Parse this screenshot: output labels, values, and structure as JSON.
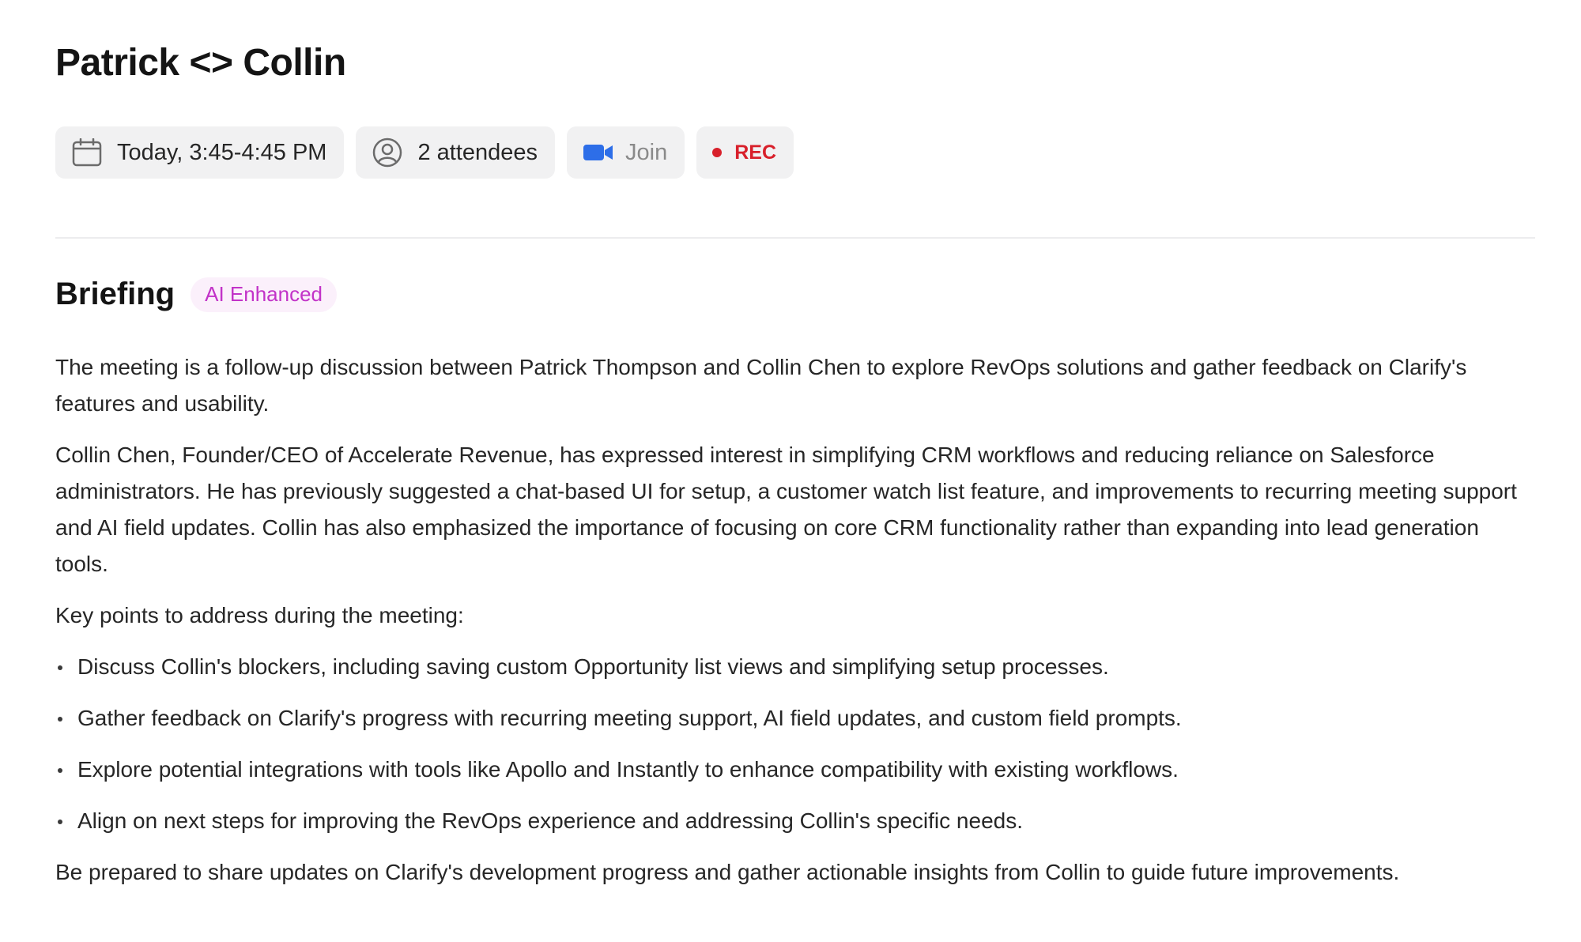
{
  "meeting": {
    "title": "Patrick <> Collin",
    "time": "Today, 3:45-4:45 PM",
    "attendees": "2 attendees",
    "join_label": "Join",
    "rec_label": "REC"
  },
  "briefing": {
    "heading": "Briefing",
    "badge": "AI Enhanced",
    "paragraphs": [
      "The meeting is a follow-up discussion between Patrick Thompson and Collin Chen to explore RevOps solutions and gather feedback on Clarify's features and usability.",
      "Collin Chen, Founder/CEO of Accelerate Revenue, has expressed interest in simplifying CRM workflows and reducing reliance on Salesforce administrators. He has previously suggested a chat-based UI for setup, a customer watch list feature, and improvements to recurring meeting support and AI field updates. Collin has also emphasized the importance of focusing on core CRM functionality rather than expanding into lead generation tools.",
      "Key points to address during the meeting:"
    ],
    "bullets": [
      "Discuss Collin's blockers, including saving custom Opportunity list views and simplifying setup processes.",
      "Gather feedback on Clarify's progress with recurring meeting support, AI field updates, and custom field prompts.",
      "Explore potential integrations with tools like Apollo and Instantly to enhance compatibility with existing workflows.",
      "Align on next steps for improving the RevOps experience and addressing Collin's specific needs."
    ],
    "closing": "Be prepared to share updates on Clarify's development progress and gather actionable insights from Collin to guide future improvements."
  },
  "icons": {
    "time": "calendar-icon",
    "attendees": "user-circle-icon",
    "join": "video-camera-icon",
    "rec": "record-dot-icon"
  },
  "colors": {
    "chip_bg": "#f1f1f2",
    "rec": "#d8202b",
    "zoom_blue": "#2d6ee8",
    "ai_badge_text": "#c233c8",
    "ai_badge_bg": "#fbf0fb"
  }
}
